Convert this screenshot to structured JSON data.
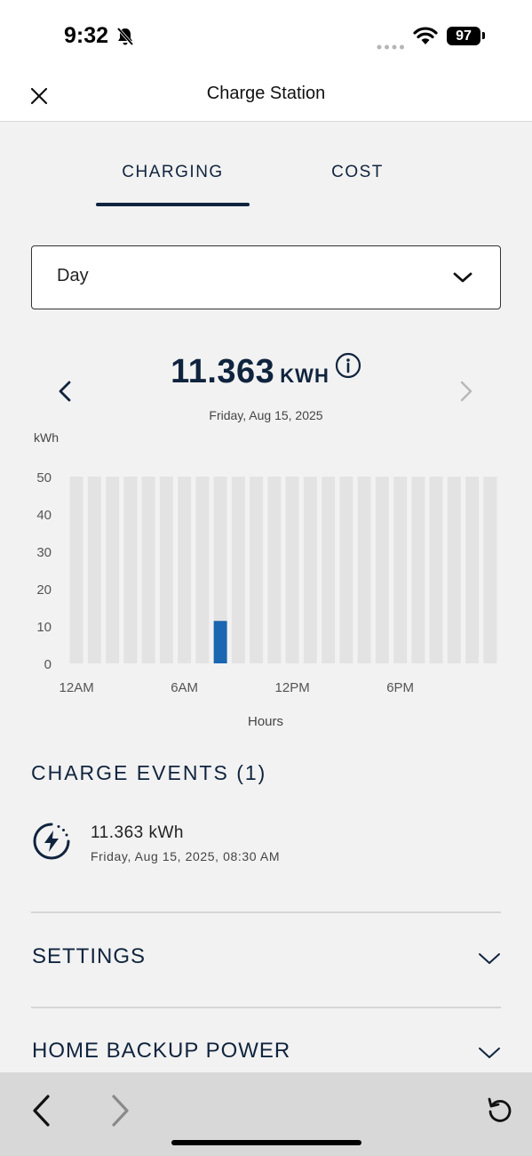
{
  "status_bar": {
    "time": "9:32",
    "battery": "97",
    "icons": [
      "bell-slash-icon",
      "signal-dots-icon",
      "wifi-icon",
      "battery-icon"
    ]
  },
  "header": {
    "title": "Charge Station",
    "close_icon": "close-icon"
  },
  "tabs": [
    {
      "label": "CHARGING",
      "active": true
    },
    {
      "label": "COST",
      "active": false
    }
  ],
  "period_select": {
    "value": "Day",
    "icon": "chevron-down-icon"
  },
  "summary": {
    "total_value": "11.363",
    "total_unit": "KWH",
    "date": "Friday, Aug 15, 2025",
    "prev_icon": "chevron-left-icon",
    "next_icon": "chevron-right-icon",
    "info_icon": "info-icon"
  },
  "chart_data": {
    "type": "bar",
    "ylabel": "kWh",
    "xlabel": "Hours",
    "ylim": [
      0,
      50
    ],
    "yticks": [
      0,
      10,
      20,
      30,
      40,
      50
    ],
    "xtick_labels": [
      "12AM",
      "6AM",
      "12PM",
      "6PM"
    ],
    "xtick_hours": [
      0,
      6,
      12,
      18
    ],
    "categories": [
      0,
      1,
      2,
      3,
      4,
      5,
      6,
      7,
      8,
      9,
      10,
      11,
      12,
      13,
      14,
      15,
      16,
      17,
      18,
      19,
      20,
      21,
      22,
      23
    ],
    "values": [
      0,
      0,
      0,
      0,
      0,
      0,
      0,
      0,
      11.363,
      0,
      0,
      0,
      0,
      0,
      0,
      0,
      0,
      0,
      0,
      0,
      0,
      0,
      0,
      0
    ],
    "bar_color": "#1a66b0",
    "background_bar_color": "#e3e3e3",
    "grid": false
  },
  "charge_events": {
    "title": "CHARGE EVENTS (1)",
    "items": [
      {
        "kwh": "11.363 kWh",
        "datetime": "Friday, Aug 15, 2025, 08:30 AM",
        "icon": "charging-bolt-icon"
      }
    ]
  },
  "sections": [
    {
      "label": "SETTINGS",
      "icon": "chevron-down-icon"
    },
    {
      "label": "HOME BACKUP POWER",
      "icon": "chevron-down-icon"
    }
  ],
  "toolbar": {
    "back_icon": "chevron-left-icon",
    "forward_icon": "chevron-right-icon",
    "reload_icon": "reload-icon"
  },
  "colors": {
    "navy": "#10243e",
    "accent_blue": "#1a66b0",
    "background": "#f2f2f2"
  }
}
